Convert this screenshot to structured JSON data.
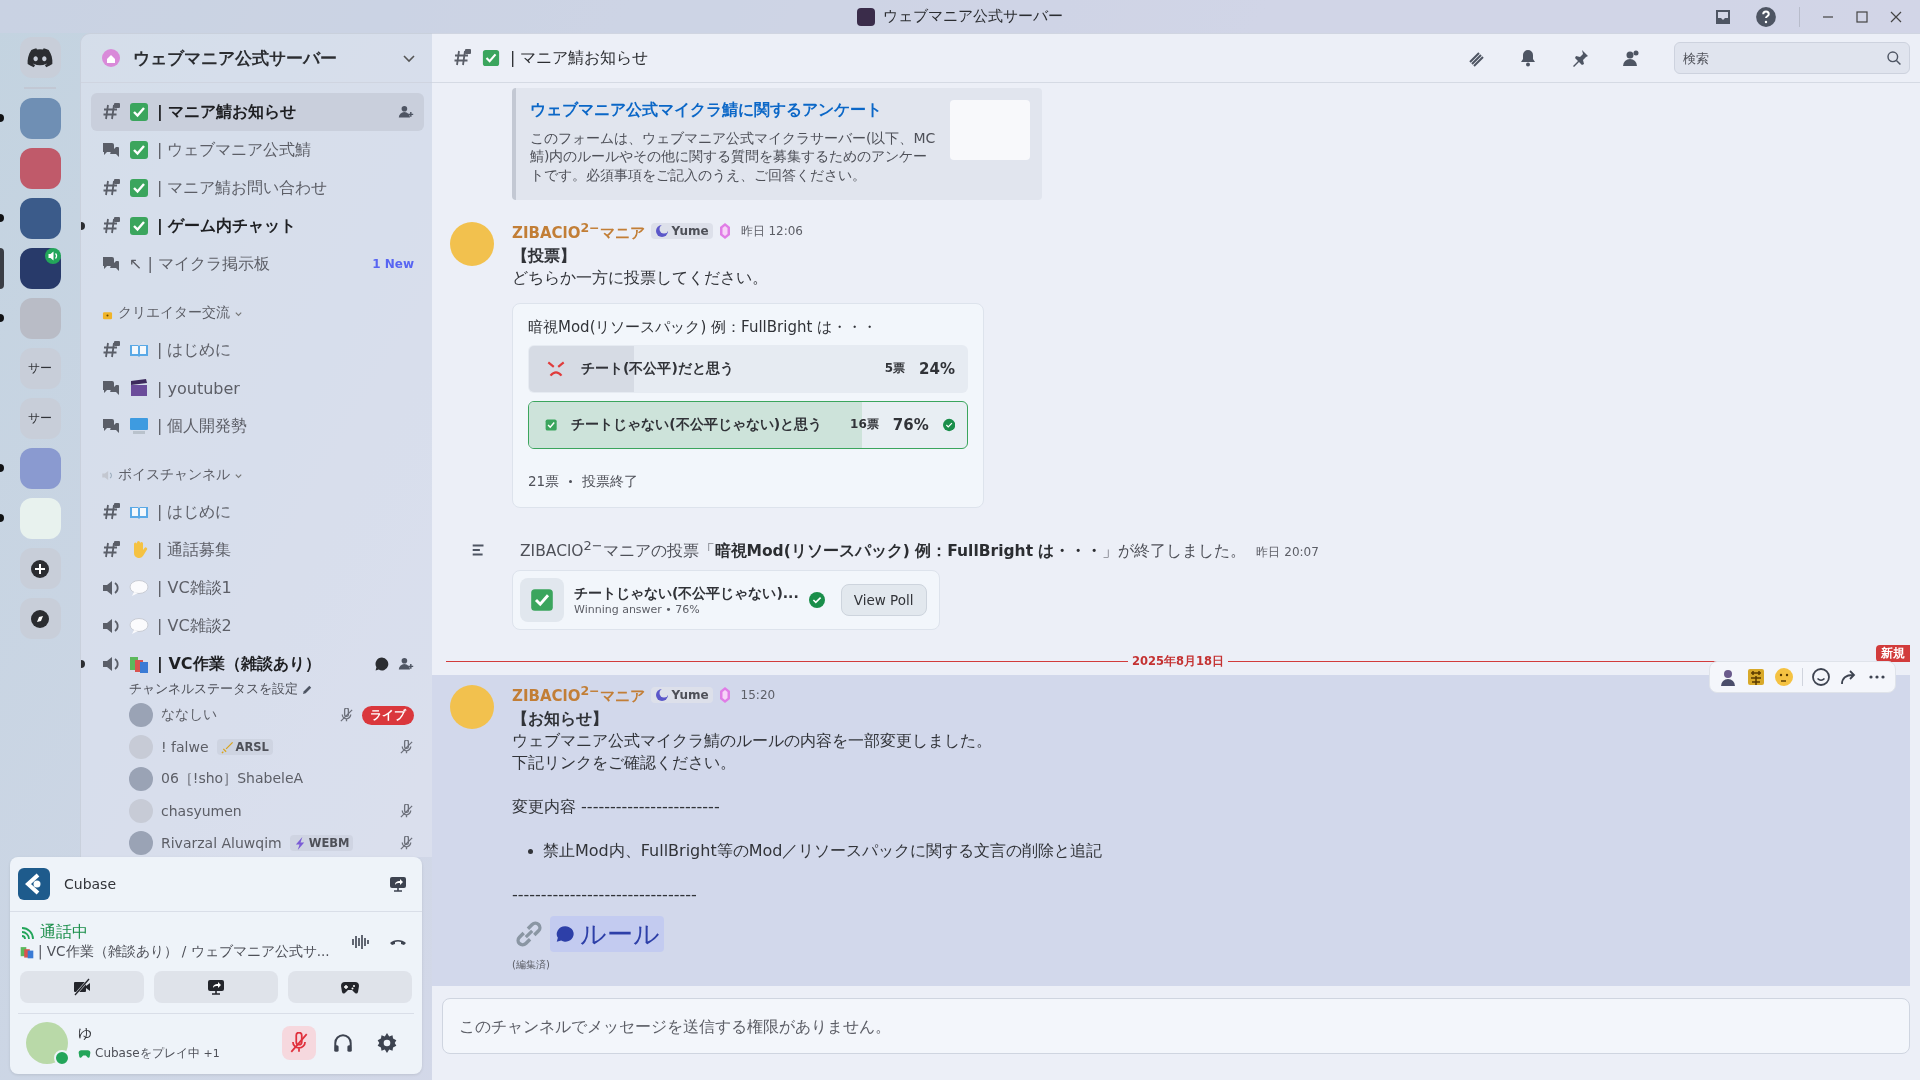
{
  "window": {
    "title": "ウェブマニア公式サーバー"
  },
  "servers": [
    {
      "kind": "home",
      "selected": false,
      "unread": false
    },
    {
      "kind": "image",
      "selected": false,
      "unread": true,
      "voice": false
    },
    {
      "kind": "image",
      "selected": false,
      "unread": false,
      "voice": false
    },
    {
      "kind": "image",
      "selected": false,
      "unread": true,
      "voice": false
    },
    {
      "kind": "image",
      "selected": true,
      "unread": false,
      "voice": true
    },
    {
      "kind": "image",
      "selected": false,
      "unread": true,
      "voice": false
    },
    {
      "kind": "text",
      "label": "サー",
      "selected": false,
      "unread": false
    },
    {
      "kind": "text",
      "label": "サー",
      "selected": false,
      "unread": false
    },
    {
      "kind": "image",
      "selected": false,
      "unread": true,
      "voice": false
    },
    {
      "kind": "image",
      "selected": false,
      "unread": true,
      "voice": false
    }
  ],
  "sidebar": {
    "server_name": "ウェブマニア公式サーバー",
    "groups": [
      {
        "channels": [
          {
            "kind": "text",
            "icon": {
              "kind": "check"
            },
            "name": "| マニア鯖お知らせ",
            "selected": true,
            "unread": true
          },
          {
            "kind": "forum",
            "icon": {
              "kind": "check"
            },
            "name": "| ウェブマニア公式鯖",
            "selected": false,
            "unread": false
          },
          {
            "kind": "text",
            "icon": {
              "kind": "check"
            },
            "name": "| マニア鯖お問い合わせ",
            "selected": false,
            "unread": false
          },
          {
            "kind": "text",
            "icon": {
              "kind": "check"
            },
            "name": "| ゲーム内チャット",
            "selected": false,
            "unread": true
          },
          {
            "kind": "forum",
            "name": "↖ | マイクラ掲示板",
            "badge": "1 New",
            "selected": false,
            "unread": false
          }
        ]
      },
      {
        "category": {
          "icon": {
            "kind": "lock"
          },
          "name": "クリエイター交流"
        },
        "channels": [
          {
            "kind": "text",
            "icon": {
              "kind": "book"
            },
            "name": "| はじめに",
            "selected": false,
            "unread": false
          },
          {
            "kind": "forum",
            "icon": {
              "kind": "clapper"
            },
            "name": "| youtuber",
            "selected": false,
            "unread": false
          },
          {
            "kind": "forum",
            "icon": {
              "kind": "computer"
            },
            "name": "| 個人開発勢",
            "selected": false,
            "unread": false
          }
        ]
      },
      {
        "category": {
          "icon": {
            "kind": "speaker"
          },
          "name": "ボイスチャンネル"
        },
        "channels": [
          {
            "kind": "text",
            "icon": {
              "kind": "book"
            },
            "name": "| はじめに",
            "selected": false,
            "unread": false
          },
          {
            "kind": "text",
            "icon": {
              "kind": "hand"
            },
            "name": "| 通話募集",
            "selected": false,
            "unread": false
          },
          {
            "kind": "voice",
            "icon": {
              "kind": "speech"
            },
            "name": "| VC雑談1",
            "selected": false,
            "unread": false
          },
          {
            "kind": "voice",
            "icon": {
              "kind": "speech"
            },
            "name": "| VC雑談2",
            "selected": false,
            "unread": false
          },
          {
            "kind": "voice",
            "icon": {
              "kind": "books"
            },
            "name": "| VC作業（雑談あり）",
            "selected": false,
            "unread": true,
            "connected": true,
            "status": "チャンネルステータスを設定",
            "users": [
              {
                "name": "ななしい",
                "muted": true,
                "live": "ライブ"
              },
              {
                "name": "! falwe",
                "tag": {
                  "kind": "sword",
                  "text": "ARSL"
                },
                "muted": true
              },
              {
                "name": "06［!sho］ShabeleA",
                "muted": false
              },
              {
                "name": "chasyumen",
                "muted": true
              },
              {
                "name": "Rivarzal Aluwqim",
                "tag": {
                  "kind": "bolt",
                  "text": "WEBM"
                },
                "muted": true
              }
            ]
          }
        ]
      }
    ]
  },
  "panel": {
    "activity": "Cubase",
    "voice_status": "通話中",
    "voice_channel": "| VC作業（雑談あり） / ウェブマニア公式サ...",
    "user": {
      "name": "ゆ",
      "activity": "Cubaseをプレイ中",
      "extra": "+1",
      "muted": true
    }
  },
  "header": {
    "icon": {
      "kind": "check"
    },
    "channel": "| マニア鯖お知らせ",
    "search": {
      "placeholder": "検索"
    }
  },
  "messages": [
    {
      "kind": "embed",
      "title": "ウェブマニア公式マイクラ鯖に関するアンケート",
      "description": "このフォームは、ウェブマニア公式マイクラサーバー(以下、MC鯖)内のルールやその他に関する質問を募集するためのアンケートです。必須事項をご記入のうえ、ご回答ください。"
    },
    {
      "kind": "message",
      "author": "ZIBAClO$^{2−}$マニア",
      "tag": "Yume",
      "time": "昨日 12:06",
      "highlighted": false,
      "lines": [
        {
          "kind": "bold",
          "text": "【投票】"
        },
        {
          "kind": "text",
          "text": "どちらか一方に投票してください。"
        }
      ],
      "poll": {
        "question": "暗視Mod(リソースパック) 例：FullBright は・・・",
        "answers": [
          {
            "icon": {
              "kind": "angry"
            },
            "text": "チート(不公平)だと思う",
            "votes": "5票",
            "percent": "24%",
            "level": 0.24,
            "winner": false
          },
          {
            "icon": {
              "kind": "check"
            },
            "text": "チートじゃない(不公平じゃない)と思う",
            "votes": "16票",
            "percent": "76%",
            "level": 0.76,
            "winner": true
          }
        ],
        "total": "21票",
        "status": "投票終了"
      }
    },
    {
      "kind": "poll-end",
      "text": "ZIBAClO$^{2−}$マニアの投票「**暗視Mod(リソースパック) 例：FullBright は・・・**」が終了しました。",
      "time": "昨日 20:07",
      "result": {
        "answer": "チートじゃない(不公平じゃない)...",
        "detail": "Winning answer • 76%",
        "button": "View Poll"
      }
    },
    {
      "kind": "divider",
      "date": "2025年8月18日",
      "badge": "新規"
    },
    {
      "kind": "message",
      "author": "ZIBAClO$^{2−}$マニア",
      "tag": "Yume",
      "time": "15:20",
      "highlighted": true,
      "lines": [
        {
          "kind": "bold",
          "text": "【お知らせ】"
        },
        {
          "kind": "text",
          "text": "ウェブマニア公式マイクラ鯖のルールの内容を一部変更しました。"
        },
        {
          "kind": "text",
          "text": "下記リンクをご確認ください。"
        },
        {
          "kind": "gap"
        },
        {
          "kind": "text",
          "text": "変更内容 ------------------------"
        },
        {
          "kind": "gap"
        },
        {
          "kind": "bullet",
          "text": "禁止Mod内、FullBright等のMod／リソースパックに関する文言の削除と追記"
        },
        {
          "kind": "gap"
        },
        {
          "kind": "text",
          "text": "--------------------------------"
        },
        {
          "kind": "link",
          "text": "ルール"
        }
      ],
      "edited": "(編集済)"
    }
  ],
  "composer": {
    "placeholder": "このチャンネルでメッセージを送信する権限がありません。"
  }
}
